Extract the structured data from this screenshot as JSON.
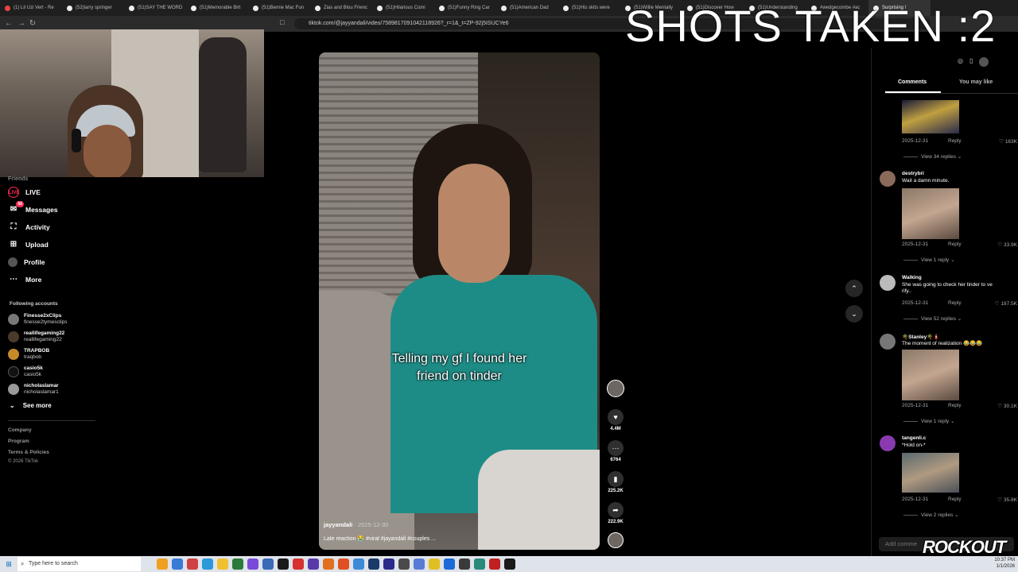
{
  "browser": {
    "tabs": [
      "(1) Lil Uzi Vert - Re",
      "(52)larry springer",
      "(51)SAY THE WORD",
      "(51)Memorable Birt",
      "(51)Bernie Mac Fun",
      "Zias and Blou Frienc",
      "(51)Hilarious Comi",
      "(51)Funny Ring Car",
      "(51)American Dad",
      "(51)His skits were",
      "(51)Willie Mentally",
      "(51)Discover How",
      "(51)Understanding",
      "#wedgecombe #ac",
      "Surprising !"
    ],
    "url": "tiktok.com/@jayyandali/video/7589817091042118926?_r=1&_t=ZP-92j5ISUCYe6"
  },
  "overlay": {
    "title": "SHOTS TAKEN :2"
  },
  "sidebar": {
    "partial_item": "Friends",
    "items": [
      {
        "label": "LIVE",
        "icon": "live-icon"
      },
      {
        "label": "Messages",
        "icon": "messages-icon",
        "badge": "56"
      },
      {
        "label": "Activity",
        "icon": "activity-icon"
      },
      {
        "label": "Upload",
        "icon": "upload-icon"
      },
      {
        "label": "Profile",
        "icon": "profile-icon"
      },
      {
        "label": "More",
        "icon": "more-icon"
      }
    ],
    "following_title": "Following accounts",
    "accounts": [
      {
        "name": "Finesse2xClips",
        "handle": "finesse2tymesclips"
      },
      {
        "name": "reallifegaming22",
        "handle": "reallifegaming22"
      },
      {
        "name": "TRAPBOB",
        "handle": "traqbob"
      },
      {
        "name": "casio5k",
        "handle": "casio5k"
      },
      {
        "name": "nicholaslamar",
        "handle": "nicholaslamar1"
      }
    ],
    "see_more": "See more",
    "footer": [
      "Company",
      "Program",
      "Terms & Policies",
      "© 2026 TikTok"
    ]
  },
  "video": {
    "caption_text": "Telling my gf I found her friend on tinder",
    "author": "jayyandali",
    "date": "· 2025-12-30",
    "description": "Late reaction 😭 #viral #jayandali #couples ..."
  },
  "actions": {
    "likes": "4.4M",
    "comments": "6764",
    "saves": "225.2K",
    "shares": "222.9K"
  },
  "panel": {
    "tab_comments": "Comments",
    "tab_you_may_like": "You may like",
    "comments": [
      {
        "user": "",
        "text": "",
        "date": "2025-12-31",
        "reply": "Reply",
        "likes": "163K",
        "view": "View 34 replies ⌄"
      },
      {
        "user": "destrybri",
        "text": "Wait a damn minute.",
        "date": "2025-12-31",
        "reply": "Reply",
        "likes": "33.9K",
        "view": "View 1 reply ⌄"
      },
      {
        "user": "Walking",
        "text": "She was going to check her tinder to ve rify..",
        "date": "2025-12-31",
        "reply": "Reply",
        "likes": "187.5K",
        "view": "View 52 replies ⌄"
      },
      {
        "user": "🌴Stanley🌴🧯",
        "text": "The moment of realization 😂😂😂",
        "date": "2025-12-31",
        "reply": "Reply",
        "likes": "30.1K",
        "view": "View 1 reply ⌄"
      },
      {
        "user": "tangenli.c",
        "text": "*Hold on-*",
        "date": "2025-12-31",
        "reply": "Reply",
        "likes": "35.8K",
        "view": "View 2 replies ⌄"
      }
    ],
    "add_comment": "Add comme"
  },
  "watermark": "ROCKOUT",
  "taskbar": {
    "search_placeholder": "Type here to search",
    "time": "10:37 PM",
    "date": "1/1/2026"
  },
  "colors": {
    "accent": "#fe2c55",
    "background": "#000000",
    "shirt": "#1e8c86"
  }
}
